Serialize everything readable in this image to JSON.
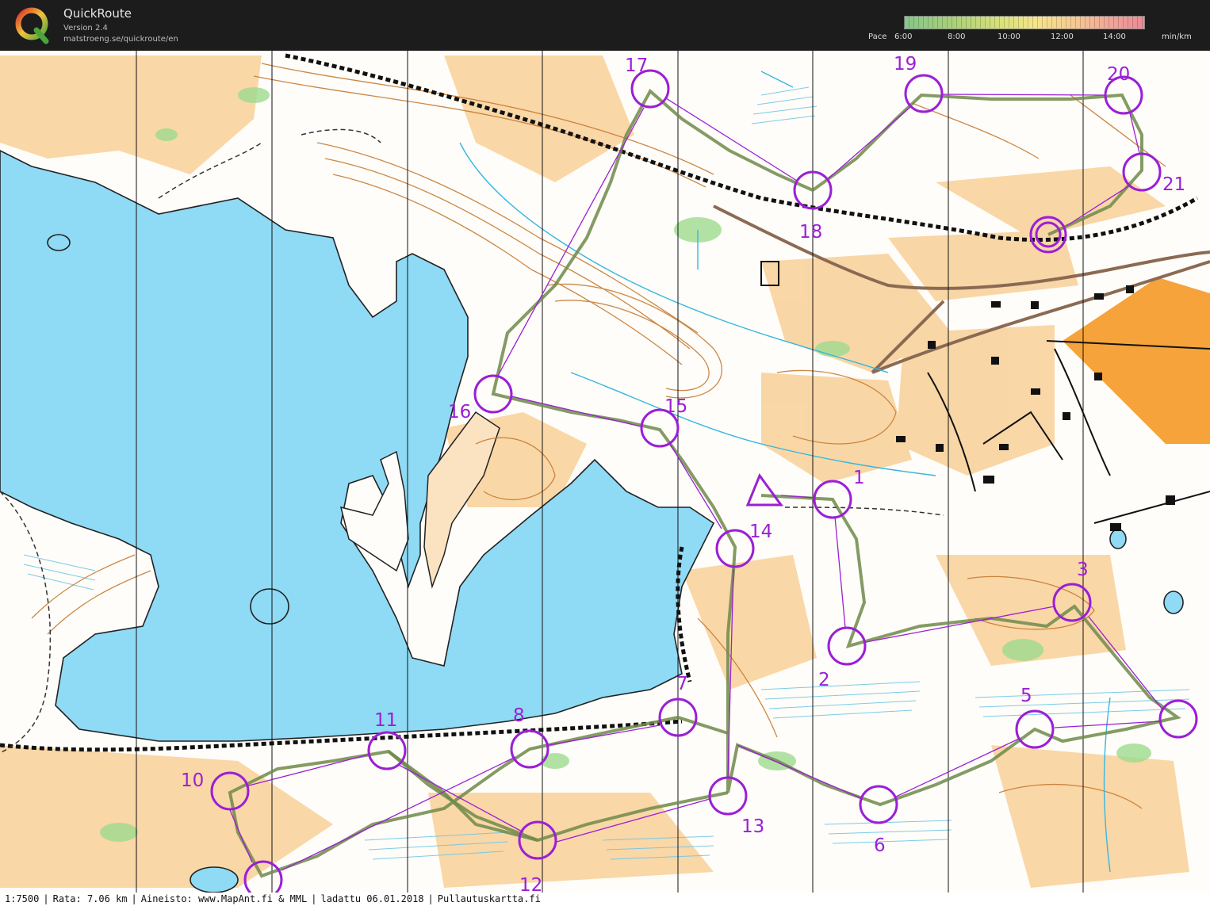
{
  "header": {
    "app_title": "QuickRoute",
    "version": "Version 2.4",
    "url": "matstroeng.se/quickroute/en",
    "pace_label": "Pace",
    "pace_ticks": [
      "6:00",
      "8:00",
      "10:00",
      "12:00",
      "14:00"
    ],
    "pace_unit": "min/km",
    "logo_icon": "quickroute-q-logo-icon"
  },
  "colors": {
    "control": "#9b1fd6",
    "water": "#8fdaf5",
    "open_land": "#f8c98a",
    "private": "#f5a33a",
    "contour": "#c77b34",
    "route": "#6f8a4a"
  },
  "map": {
    "controls": [
      {
        "label": "1"
      },
      {
        "label": "2"
      },
      {
        "label": "3"
      },
      {
        "label": "5"
      },
      {
        "label": "6"
      },
      {
        "label": "7"
      },
      {
        "label": "8"
      },
      {
        "label": "10"
      },
      {
        "label": "11"
      },
      {
        "label": "12"
      },
      {
        "label": "13"
      },
      {
        "label": "14"
      },
      {
        "label": "15"
      },
      {
        "label": "16"
      },
      {
        "label": "17"
      },
      {
        "label": "18"
      },
      {
        "label": "19"
      },
      {
        "label": "20"
      },
      {
        "label": "21"
      }
    ],
    "start_icon": "start-triangle-icon",
    "finish_icon": "finish-double-circle-icon"
  },
  "footer": {
    "scale": "1:7500",
    "course": "Rata: 7.06 km",
    "source": "Aineisto: www.MapAnt.fi & MML",
    "loaded": "ladattu 06.01.2018",
    "credit": "Pullautuskartta.fi"
  }
}
